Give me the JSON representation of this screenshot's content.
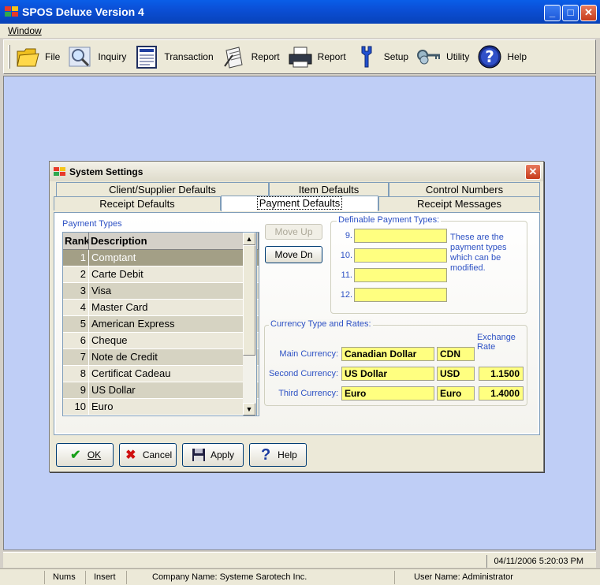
{
  "window": {
    "title": "SPOS Deluxe Version 4"
  },
  "menu": {
    "window_label": "Window"
  },
  "toolbar": [
    {
      "label": "File",
      "icon": "folder-icon"
    },
    {
      "label": "Inquiry",
      "icon": "magnifier-icon"
    },
    {
      "label": "Transaction",
      "icon": "document-icon"
    },
    {
      "label": "Report",
      "icon": "report-pen-icon"
    },
    {
      "label": "Report",
      "icon": "printer-icon"
    },
    {
      "label": "Setup",
      "icon": "wrench-icon"
    },
    {
      "label": "Utility",
      "icon": "keys-icon"
    },
    {
      "label": "Help",
      "icon": "help-icon"
    }
  ],
  "dialog": {
    "title": "System Settings",
    "tabs_back": [
      "Client/Supplier Defaults",
      "Item Defaults",
      "Control Numbers"
    ],
    "tabs_front": [
      "Receipt Defaults",
      "Payment Defaults",
      "Receipt Messages"
    ],
    "payment_types_label": "Payment Types",
    "grid_headers": {
      "rank": "Rank",
      "description": "Description"
    },
    "payment_types": [
      {
        "rank": "1",
        "description": "Comptant"
      },
      {
        "rank": "2",
        "description": "Carte Debit"
      },
      {
        "rank": "3",
        "description": "Visa"
      },
      {
        "rank": "4",
        "description": "Master Card"
      },
      {
        "rank": "5",
        "description": "American Express"
      },
      {
        "rank": "6",
        "description": "Cheque"
      },
      {
        "rank": "7",
        "description": "Note de Credit"
      },
      {
        "rank": "8",
        "description": "Certificat Cadeau"
      },
      {
        "rank": "9",
        "description": "US Dollar"
      },
      {
        "rank": "10",
        "description": "Euro"
      }
    ],
    "move_up": "Move Up",
    "move_down": "Move Dn",
    "definable_label": "Definable Payment Types:",
    "definable": [
      {
        "num": "9.",
        "value": ""
      },
      {
        "num": "10.",
        "value": ""
      },
      {
        "num": "11.",
        "value": ""
      },
      {
        "num": "12.",
        "value": ""
      }
    ],
    "definable_note": "These are the payment types which can be modified.",
    "currency_label": "Currency Type and Rates:",
    "exchange_rate_label": "Exchange Rate",
    "currencies": [
      {
        "label": "Main Currency:",
        "name": "Canadian Dollar",
        "code": "CDN",
        "rate": ""
      },
      {
        "label": "Second Currency:",
        "name": "US Dollar",
        "code": "USD",
        "rate": "1.1500"
      },
      {
        "label": "Third Currency:",
        "name": "Euro",
        "code": "Euro",
        "rate": "1.4000"
      }
    ],
    "buttons": {
      "ok": "OK",
      "cancel": "Cancel",
      "apply": "Apply",
      "help": "Help"
    }
  },
  "status": {
    "datetime": "04/11/2006  5:20:03 PM",
    "nums": "Nums",
    "insert": "Insert",
    "company": "Company Name: Systeme Sarotech Inc.",
    "user": "User Name: Administrator"
  }
}
